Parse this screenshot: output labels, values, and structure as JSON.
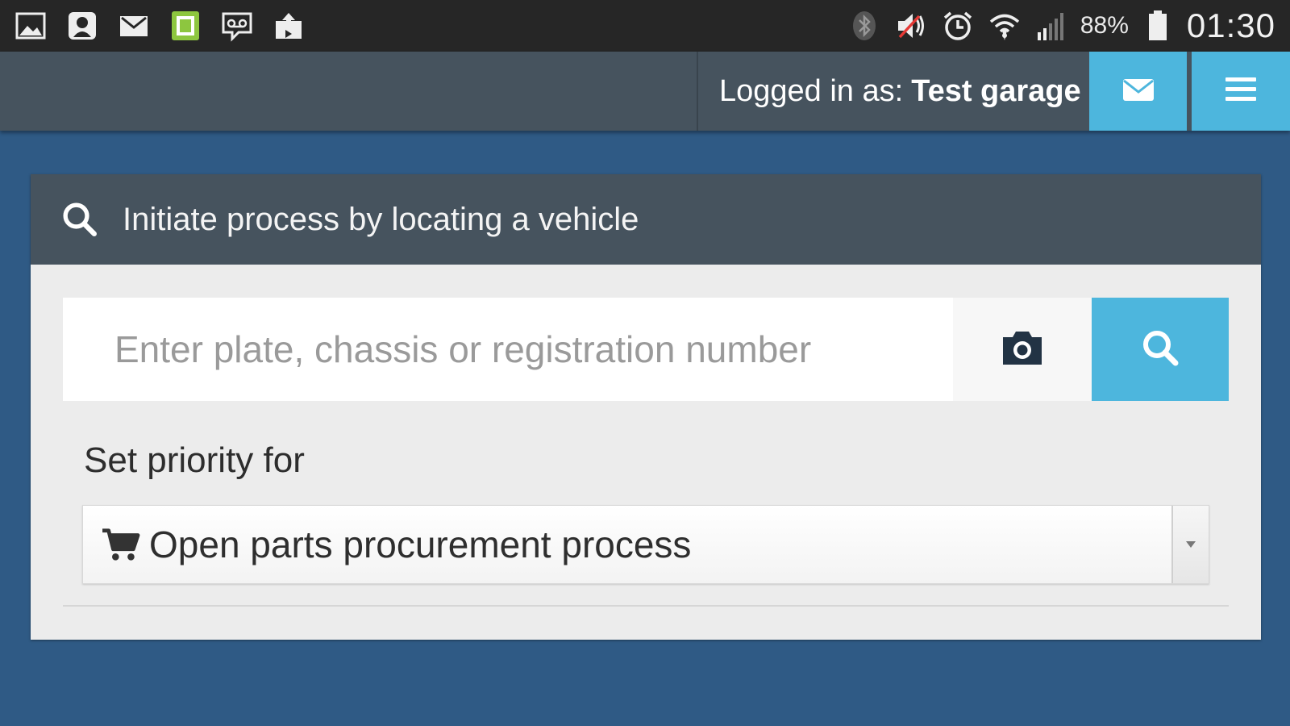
{
  "statusbar": {
    "left_icons": [
      "gallery-icon",
      "contacts-app-icon",
      "gmail-icon",
      "green-app-icon",
      "voicemail-icon",
      "upload-icon"
    ],
    "right_icons": [
      "bluetooth-icon",
      "volume-muted-icon",
      "alarm-icon",
      "wifi-icon",
      "signal-icon",
      "battery-icon"
    ],
    "battery_percent": "88%",
    "time": "01:30"
  },
  "navbar": {
    "login_prefix": "Logged in as:",
    "login_user": "Test garage",
    "mail_icon": "envelope-icon",
    "menu_icon": "hamburger-menu-icon",
    "accent_color": "#4db6dd"
  },
  "panel": {
    "header_icon": "search-icon",
    "title": "Initiate process by locating a vehicle",
    "search_placeholder": "Enter plate, chassis or registration number",
    "search_value": "",
    "camera_icon": "camera-icon",
    "search_button_icon": "search-icon",
    "priority_label": "Set priority for",
    "priority_icon": "shopping-cart-icon",
    "priority_selected": "Open parts procurement process"
  },
  "colors": {
    "background": "#2f5a85",
    "navbar": "#46535e",
    "accent": "#4db6dd"
  }
}
